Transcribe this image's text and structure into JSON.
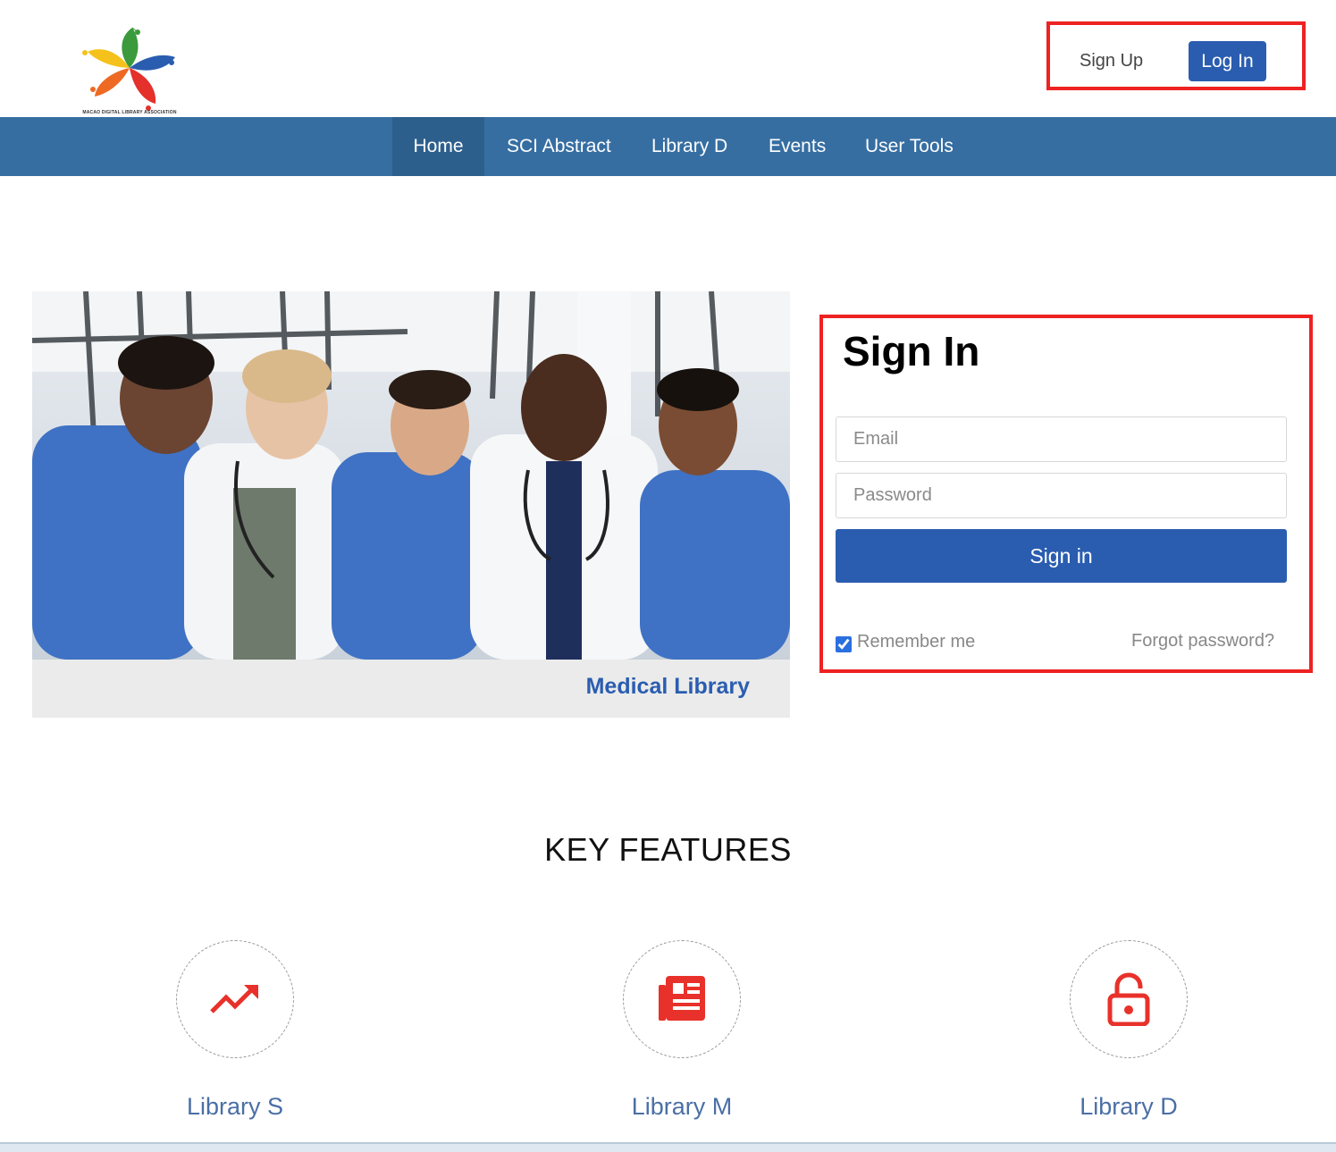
{
  "header": {
    "logo_text": "MACAO DIGITAL LIBRARY ASSOCIATION",
    "signup_label": "Sign Up",
    "login_label": "Log In"
  },
  "nav": {
    "items": [
      {
        "label": "Home",
        "active": true
      },
      {
        "label": "SCI Abstract",
        "active": false
      },
      {
        "label": "Library D",
        "active": false
      },
      {
        "label": "Events",
        "active": false
      },
      {
        "label": "User Tools",
        "active": false
      }
    ]
  },
  "hero": {
    "caption": "Medical Library"
  },
  "signin": {
    "title": "Sign In",
    "email_placeholder": "Email",
    "password_placeholder": "Password",
    "button_label": "Sign in",
    "remember_label": "Remember me",
    "remember_checked": true,
    "forgot_label": "Forgot password?"
  },
  "features": {
    "title": "KEY FEATURES",
    "items": [
      {
        "label": "Library S",
        "icon": "trending-up-icon"
      },
      {
        "label": "Library M",
        "icon": "newspaper-icon"
      },
      {
        "label": "Library D",
        "icon": "unlock-icon"
      }
    ]
  },
  "colors": {
    "nav_bg": "#366ea2",
    "nav_active": "#2d5f8d",
    "primary": "#2a5db0",
    "highlight_border": "#ee2222",
    "feature_icon": "#e8312a",
    "feature_label": "#4a6fa5"
  }
}
